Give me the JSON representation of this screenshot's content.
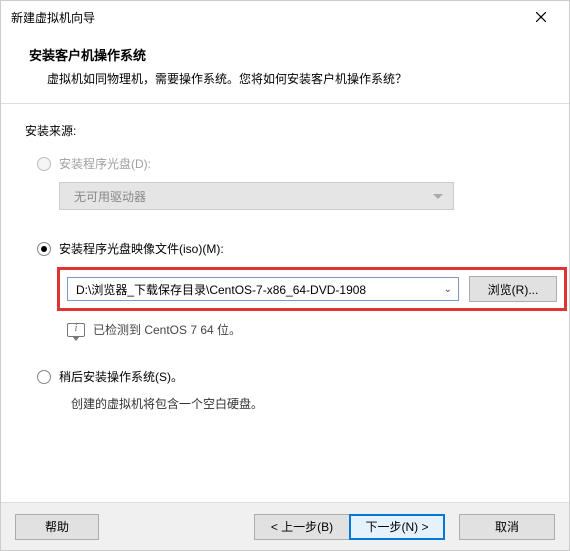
{
  "window": {
    "title": "新建虚拟机向导"
  },
  "header": {
    "heading": "安装客户机操作系统",
    "subtext": "虚拟机如同物理机，需要操作系统。您将如何安装客户机操作系统？"
  },
  "source_label": "安装来源:",
  "option_disc": {
    "label": "安装程序光盘(D):",
    "driver_text": "无可用驱动器"
  },
  "option_iso": {
    "label": "安装程序光盘映像文件(iso)(M):",
    "path": "D:\\浏览器_下载保存目录\\CentOS-7-x86_64-DVD-1908",
    "browse": "浏览(R)...",
    "detected": "已检测到 CentOS 7 64 位。"
  },
  "option_later": {
    "label": "稍后安装操作系统(S)。",
    "desc": "创建的虚拟机将包含一个空白硬盘。"
  },
  "buttons": {
    "help": "帮助",
    "back": "< 上一步(B)",
    "next": "下一步(N) >",
    "cancel": "取消"
  }
}
